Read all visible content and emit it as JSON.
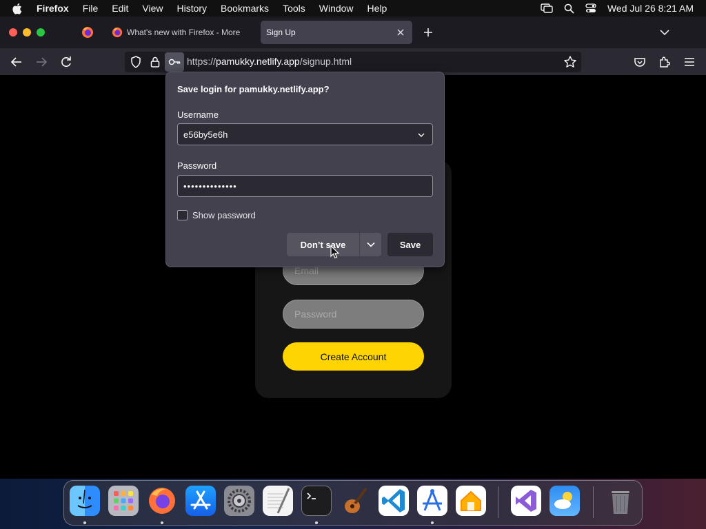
{
  "menubar": {
    "app_name": "Firefox",
    "items": [
      "File",
      "Edit",
      "View",
      "History",
      "Bookmarks",
      "Tools",
      "Window",
      "Help"
    ],
    "datetime": "Wed Jul 26  8:21 AM"
  },
  "tabs": [
    {
      "title": "What's new with Firefox - More",
      "active": false
    },
    {
      "title": "Sign Up",
      "active": true
    }
  ],
  "urlbar": {
    "prefix": "https://",
    "host": "pamukky.netlify.app",
    "path": "/signup.html"
  },
  "page": {
    "email_placeholder": "Email",
    "password_placeholder": "Password",
    "create_button": "Create Account"
  },
  "popup": {
    "title": "Save login for pamukky.netlify.app?",
    "username_label": "Username",
    "username_value": "e56by5e6h",
    "password_label": "Password",
    "password_value": "••••••••••••••",
    "show_password_label": "Show password",
    "show_password_checked": false,
    "dont_save_label": "Don’t save",
    "save_label": "Save"
  },
  "dock": {
    "apps": [
      "Finder",
      "Launchpad",
      "Firefox",
      "App Store",
      "System Settings",
      "TextEdit",
      "Terminal",
      "GarageBand",
      "Visual Studio Code",
      "Instruments",
      "Home",
      "Visual Studio",
      "Weather",
      "Trash"
    ]
  },
  "colors": {
    "accent_yellow": "#ffd400",
    "popup_bg": "#42414d",
    "toolbar_bg": "#2b2a33",
    "tabstrip_bg": "#1c1b22"
  }
}
